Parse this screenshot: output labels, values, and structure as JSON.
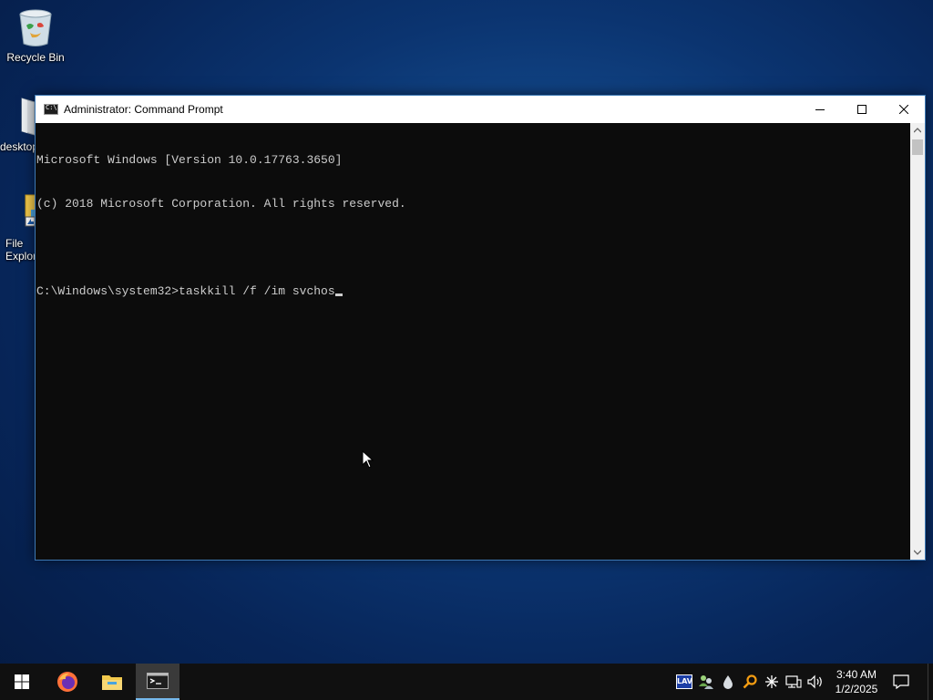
{
  "desktop": {
    "icons": [
      {
        "label": "Recycle Bin",
        "icon": "recycle-bin-icon"
      },
      {
        "label": "desktop",
        "icon": "folder-icon"
      },
      {
        "label": "File Explorer",
        "icon": "file-explorer-icon"
      }
    ]
  },
  "window": {
    "title": "Administrator: Command Prompt",
    "icon": "cmd-icon",
    "controls": {
      "minimize": "minimize-icon",
      "maximize": "maximize-icon",
      "close": "close-icon"
    }
  },
  "console": {
    "lines": [
      "Microsoft Windows [Version 10.0.17763.3650]",
      "(c) 2018 Microsoft Corporation. All rights reserved.",
      "",
      "C:\\Windows\\system32>taskkill /f /im svchos"
    ]
  },
  "taskbar": {
    "start": "windows-start-icon",
    "apps": [
      {
        "name": "Firefox",
        "icon": "firefox-icon",
        "active": false
      },
      {
        "name": "File Explorer",
        "icon": "file-explorer-icon",
        "active": false
      },
      {
        "name": "Command Prompt",
        "icon": "cmd-icon",
        "active": true
      }
    ],
    "tray": [
      "lav-icon",
      "people-network-icon",
      "droplet-icon",
      "search-magnifier-icon",
      "asterisk-icon",
      "network-icon",
      "volume-icon"
    ],
    "tray_lav_text": "LAV",
    "clock": {
      "time": "3:40 AM",
      "date": "1/2/2025"
    }
  },
  "colors": {
    "console_bg": "#0c0c0c",
    "console_fg": "#cccccc",
    "taskbar": "#101010",
    "accent": "#76b9ed"
  }
}
